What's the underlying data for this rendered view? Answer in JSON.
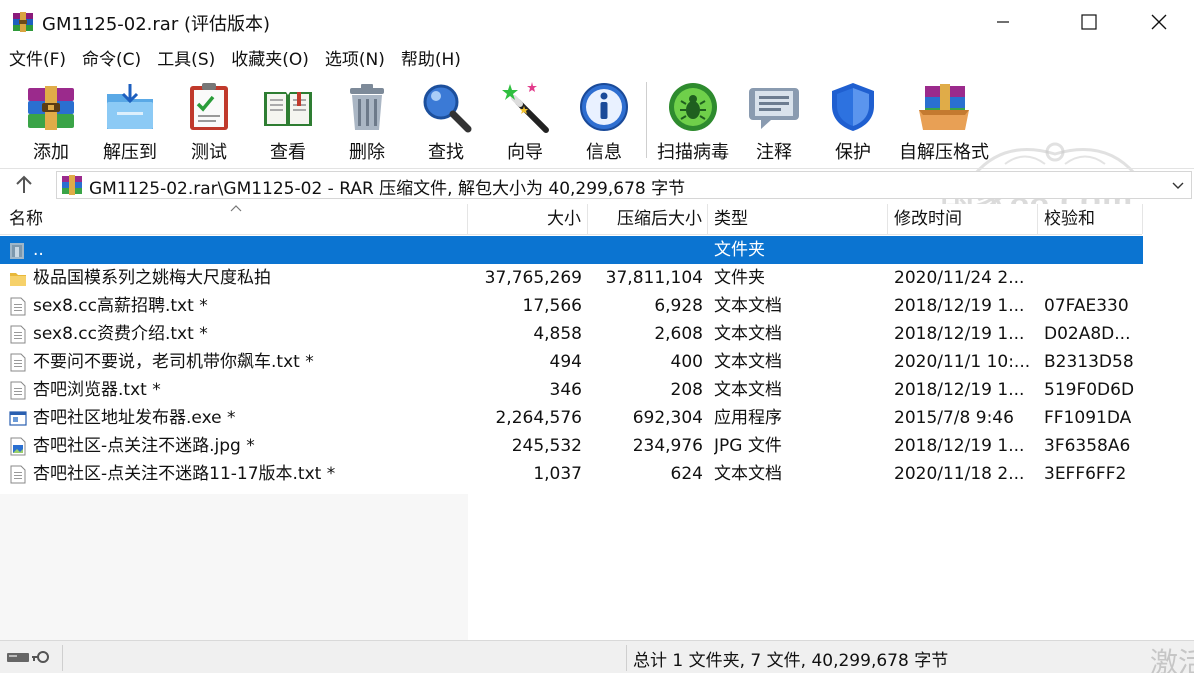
{
  "window": {
    "title": "GM1125-02.rar (评估版本)",
    "minimize_label": "minimize",
    "maximize_label": "maximize",
    "close_label": "close"
  },
  "menu": [
    {
      "label": "文件(F)"
    },
    {
      "label": "命令(C)"
    },
    {
      "label": "工具(S)"
    },
    {
      "label": "收藏夹(O)"
    },
    {
      "label": "选项(N)"
    },
    {
      "label": "帮助(H)"
    }
  ],
  "toolbar": [
    {
      "label": "添加",
      "icon": "add-archive-icon"
    },
    {
      "label": "解压到",
      "icon": "extract-to-icon"
    },
    {
      "label": "测试",
      "icon": "test-icon"
    },
    {
      "label": "查看",
      "icon": "view-icon"
    },
    {
      "label": "删除",
      "icon": "delete-icon"
    },
    {
      "label": "查找",
      "icon": "find-icon"
    },
    {
      "label": "向导",
      "icon": "wizard-icon"
    },
    {
      "label": "信息",
      "icon": "info-icon"
    },
    {
      "label": "扫描病毒",
      "icon": "virus-scan-icon"
    },
    {
      "label": "注释",
      "icon": "comment-icon"
    },
    {
      "label": "保护",
      "icon": "protect-icon"
    },
    {
      "label": "自解压格式",
      "icon": "sfx-icon"
    }
  ],
  "watermark": "国家88.com",
  "address": {
    "path": "GM1125-02.rar\\GM1125-02 - RAR 压缩文件, 解包大小为 40,299,678 字节"
  },
  "columns": {
    "name": "名称",
    "size": "大小",
    "packed": "压缩后大小",
    "type": "类型",
    "modified": "修改时间",
    "crc": "校验和"
  },
  "files": [
    {
      "name": "..",
      "size": "",
      "packed": "",
      "type": "文件夹",
      "modified": "",
      "crc": "",
      "icon": "parent-folder-icon",
      "selected": true
    },
    {
      "name": "极品国模系列之姚梅大尺度私拍",
      "size": "37,765,269",
      "packed": "37,811,104",
      "type": "文件夹",
      "modified": "2020/11/24 2...",
      "crc": "",
      "icon": "folder-icon",
      "selected": false
    },
    {
      "name": "sex8.cc高薪招聘.txt *",
      "size": "17,566",
      "packed": "6,928",
      "type": "文本文档",
      "modified": "2018/12/19 1...",
      "crc": "07FAE330",
      "icon": "text-file-icon",
      "selected": false
    },
    {
      "name": "sex8.cc资费介绍.txt *",
      "size": "4,858",
      "packed": "2,608",
      "type": "文本文档",
      "modified": "2018/12/19 1...",
      "crc": "D02A8D...",
      "icon": "text-file-icon",
      "selected": false
    },
    {
      "name": "不要问不要说，老司机带你飙车.txt *",
      "size": "494",
      "packed": "400",
      "type": "文本文档",
      "modified": "2020/11/1 10:...",
      "crc": "B2313D58",
      "icon": "text-file-icon",
      "selected": false
    },
    {
      "name": "杏吧浏览器.txt *",
      "size": "346",
      "packed": "208",
      "type": "文本文档",
      "modified": "2018/12/19 1...",
      "crc": "519F0D6D",
      "icon": "text-file-icon",
      "selected": false
    },
    {
      "name": "杏吧社区地址发布器.exe *",
      "size": "2,264,576",
      "packed": "692,304",
      "type": "应用程序",
      "modified": "2015/7/8 9:46",
      "crc": "FF1091DA",
      "icon": "exe-file-icon",
      "selected": false
    },
    {
      "name": "杏吧社区-点关注不迷路.jpg *",
      "size": "245,532",
      "packed": "234,976",
      "type": "JPG 文件",
      "modified": "2018/12/19 1...",
      "crc": "3F6358A6",
      "icon": "image-file-icon",
      "selected": false
    },
    {
      "name": "杏吧社区-点关注不迷路11-17版本.txt *",
      "size": "1,037",
      "packed": "624",
      "type": "文本文档",
      "modified": "2020/11/18 2...",
      "crc": "3EFF6FF2",
      "icon": "text-file-icon",
      "selected": false
    }
  ],
  "status": {
    "summary": "总计 1 文件夹, 7 文件, 40,299,678 字节",
    "corner_watermark": "激活"
  },
  "colors": {
    "selection": "#0b74d1",
    "background": "#ffffff",
    "statusbar": "#f0f0f0"
  }
}
